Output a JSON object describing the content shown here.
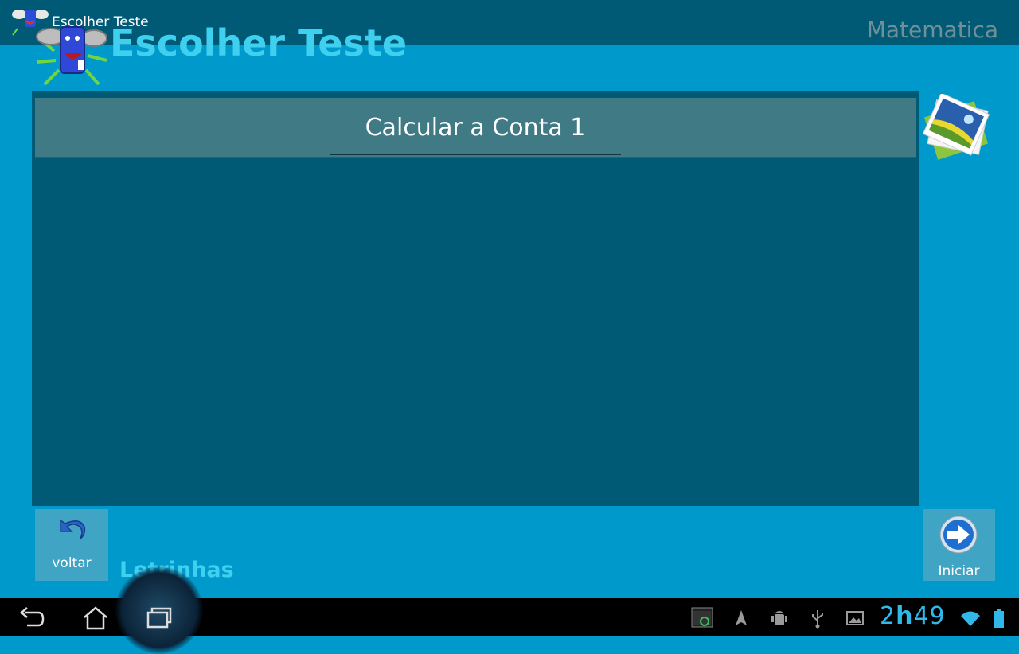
{
  "titlebar": {
    "app_title": "Escolher Teste",
    "subject": "Matematica"
  },
  "header": {
    "title": "Escolher Teste"
  },
  "test_selector": {
    "selected_value": "Calcular a Conta 1"
  },
  "footer": {
    "back_label": "voltar",
    "category_label": "Letrinhas",
    "start_label": "Iniciar"
  },
  "system_bar": {
    "clock_hour": "2",
    "clock_sep": "h",
    "clock_minutes": "49",
    "icons": [
      "back-icon",
      "home-icon",
      "recent-apps-icon",
      "screenshot-app-icon",
      "location-icon",
      "android-debug-icon",
      "usb-icon",
      "gallery-notification-icon",
      "wifi-icon",
      "battery-icon"
    ]
  },
  "colors": {
    "background": "#0099cc",
    "titlebar": "#005a75",
    "panel": "#005a75",
    "accent_text": "#3fcfef",
    "clock": "#2fb8e8"
  }
}
